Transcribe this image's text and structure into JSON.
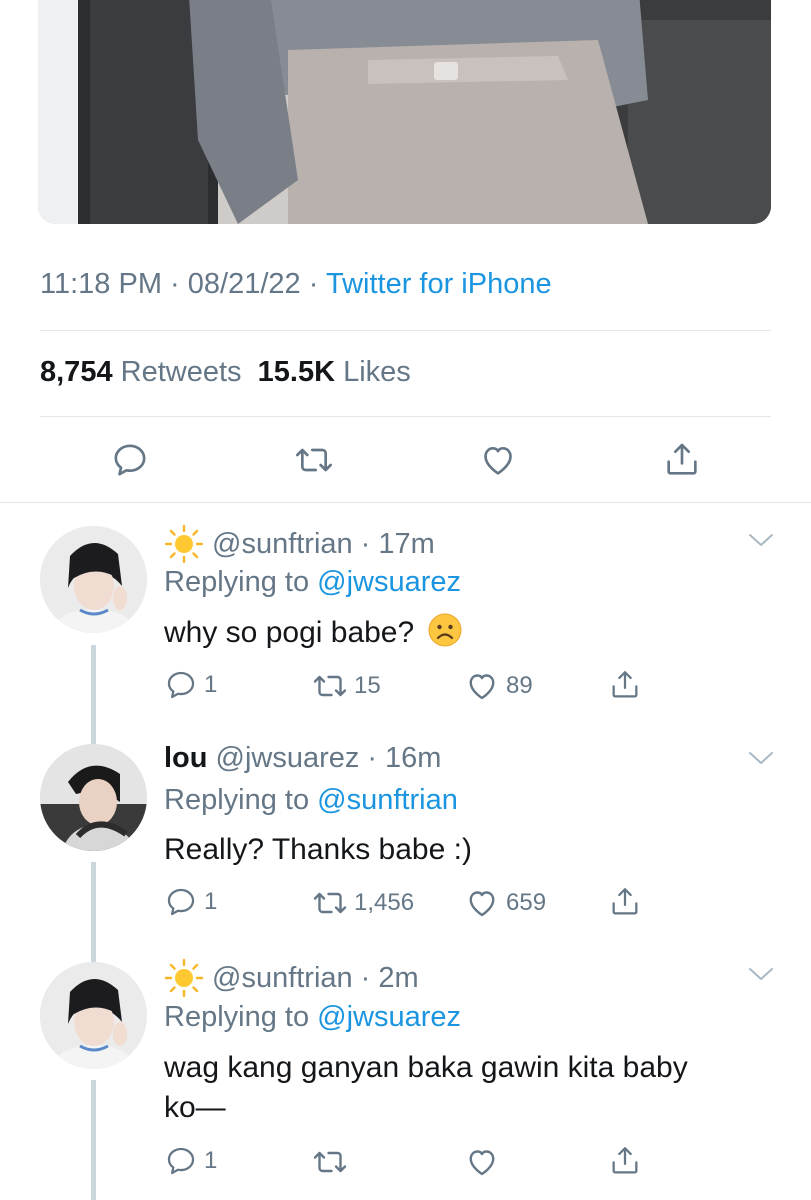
{
  "tweet": {
    "time": "11:18 PM",
    "date": "08/21/22",
    "separator": "·",
    "source": "Twitter for iPhone",
    "retweets_count": "8,754",
    "retweets_label": "Retweets",
    "likes_count": "15.5K",
    "likes_label": "Likes"
  },
  "icons": {
    "reply": "reply-icon",
    "retweet": "retweet-icon",
    "like": "heart-icon",
    "share": "share-icon",
    "more": "chevron-down-icon",
    "sun": "sun-emoji",
    "frown": "frowning-face-emoji"
  },
  "replies": [
    {
      "name": "",
      "handle": "@sunftrian",
      "age": "17m",
      "replying_prefix": "Replying to",
      "replying_to": "@jwsuarez",
      "text": "why so pogi babe?",
      "reply_count": "1",
      "retweet_count": "15",
      "like_count": "89"
    },
    {
      "name": "lou",
      "handle": "@jwsuarez",
      "age": "16m",
      "replying_prefix": "Replying to",
      "replying_to": "@sunftrian",
      "text": "Really? Thanks babe :)",
      "reply_count": "1",
      "retweet_count": "1,456",
      "like_count": "659"
    },
    {
      "name": "",
      "handle": "@sunftrian",
      "age": "2m",
      "replying_prefix": "Replying to",
      "replying_to": "@jwsuarez",
      "text": "wag kang ganyan baka gawin kita baby ko—",
      "reply_count": "1",
      "retweet_count": "",
      "like_count": ""
    }
  ],
  "colors": {
    "link": "#1b95e0",
    "muted": "#657786",
    "text": "#14171a",
    "divider": "#e1e8ed"
  }
}
